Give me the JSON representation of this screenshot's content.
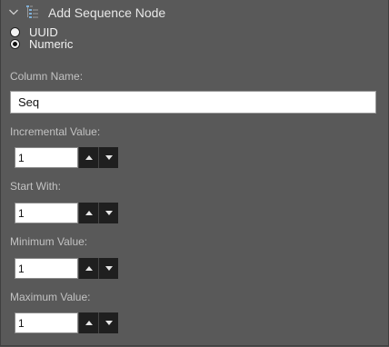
{
  "header": {
    "title": "Add Sequence Node",
    "collapse_icon": "chevron-down-icon",
    "node_icon": "sequence-list-icon"
  },
  "id_type": {
    "options": [
      {
        "label": "UUID",
        "selected": false
      },
      {
        "label": "Numeric",
        "selected": true
      }
    ]
  },
  "column_name": {
    "label": "Column Name:",
    "value": "Seq"
  },
  "incremental_value": {
    "label": "Incremental Value:",
    "value": "1"
  },
  "start_with": {
    "label": "Start With:",
    "value": "1"
  },
  "minimum_value": {
    "label": "Minimum Value:",
    "value": "1"
  },
  "maximum_value": {
    "label": "Maximum Value:",
    "value": "1"
  },
  "colors": {
    "panel_bg": "#595959",
    "label_text": "#c2c2c2",
    "stepper_button": "#1f1f1f",
    "icon_accent": "#7fb0d8"
  }
}
